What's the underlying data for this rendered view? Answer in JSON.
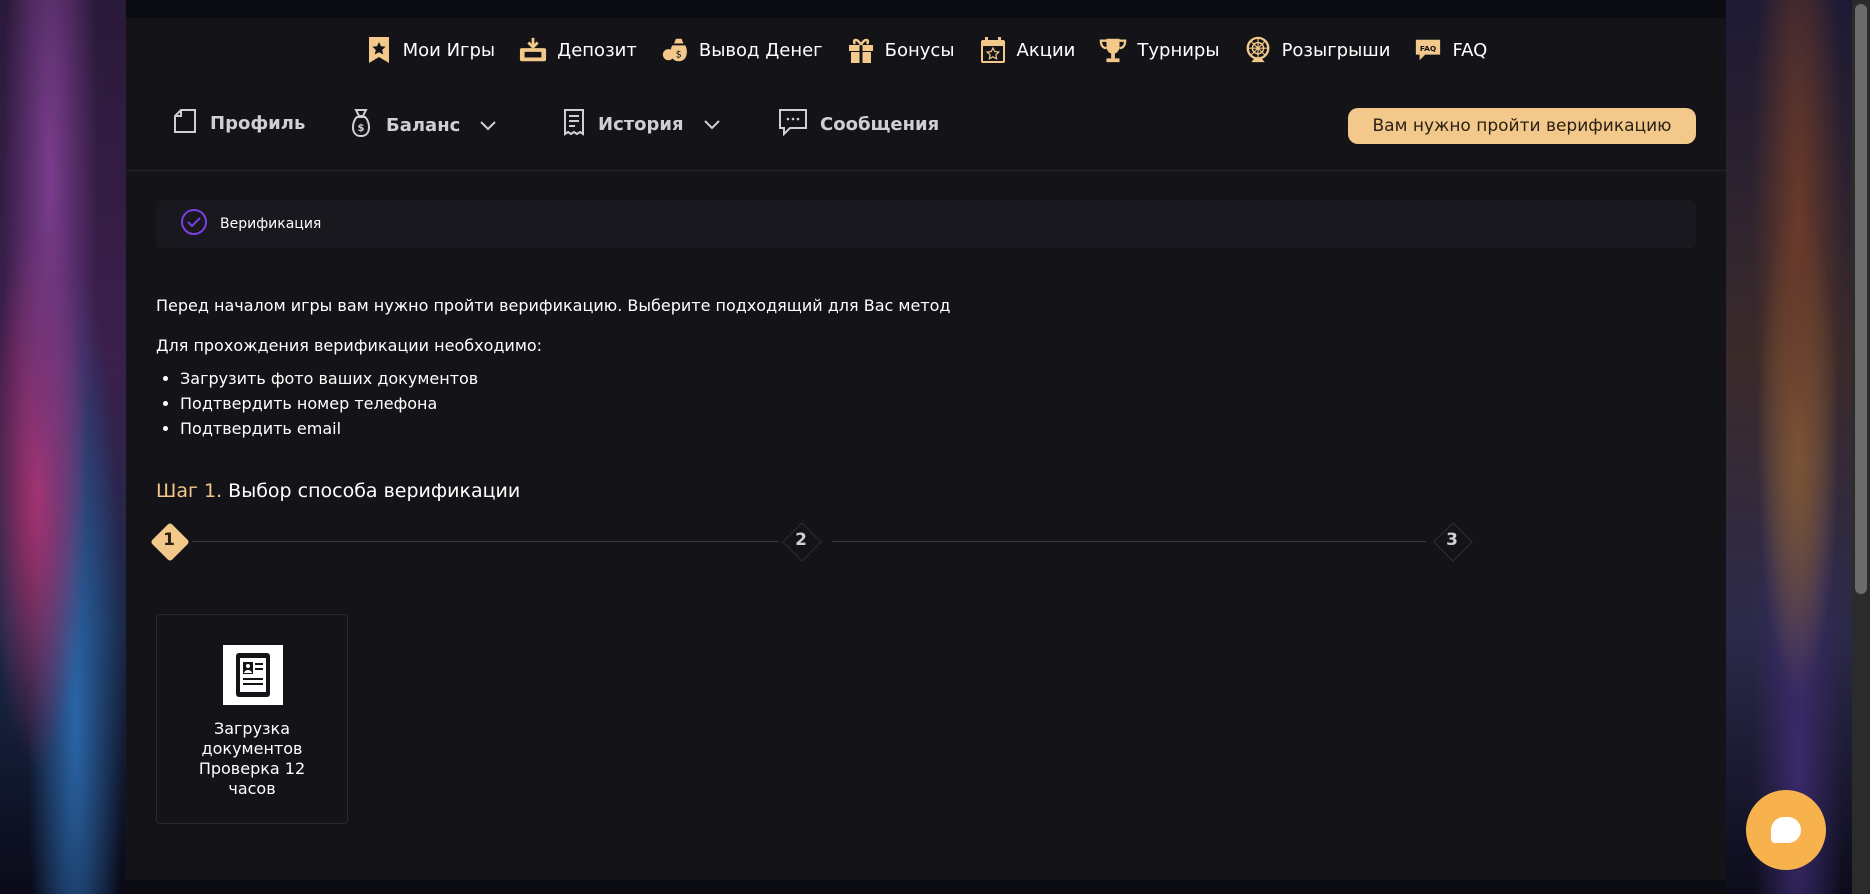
{
  "nav": {
    "items": [
      {
        "label": "Мои Игры",
        "icon": "star-bookmark-icon"
      },
      {
        "label": "Депозит",
        "icon": "deposit-icon"
      },
      {
        "label": "Вывод Денег",
        "icon": "money-bag-icon"
      },
      {
        "label": "Бонусы",
        "icon": "gift-icon"
      },
      {
        "label": "Акции",
        "icon": "calendar-star-icon"
      },
      {
        "label": "Турниры",
        "icon": "trophy-icon"
      },
      {
        "label": "Розыгрыши",
        "icon": "prize-wheel-icon"
      },
      {
        "label": "FAQ",
        "icon": "faq-badge-icon",
        "badge": "FAQ"
      }
    ]
  },
  "subnav": {
    "profile": "Профиль",
    "balance": "Баланс",
    "history": "История",
    "messages": "Сообщения",
    "verify_button": "Вам нужно пройти верификацию"
  },
  "verification": {
    "header": "Верификация",
    "intro": "Перед началом игры вам нужно пройти верификацию. Выберите подходящий для Вас метод",
    "requirements_title": "Для прохождения верификации необходимо:",
    "requirements": [
      "Загрузить фото ваших документов",
      "Подтвердить номер телефона",
      "Подтвердить email"
    ],
    "step_prefix": "Шаг 1.",
    "step_title": "Выбор способа верификации",
    "steps": [
      "1",
      "2",
      "3"
    ],
    "active_step": 1,
    "method": {
      "line1": "Загрузка",
      "line2": "документов",
      "line3": "Проверка 12",
      "line4": "часов",
      "icon": "document-id-icon"
    }
  },
  "colors": {
    "accent": "#f2c98a",
    "panel": "#141418",
    "chat": "#f7b24d",
    "check": "#7b3fe4"
  }
}
